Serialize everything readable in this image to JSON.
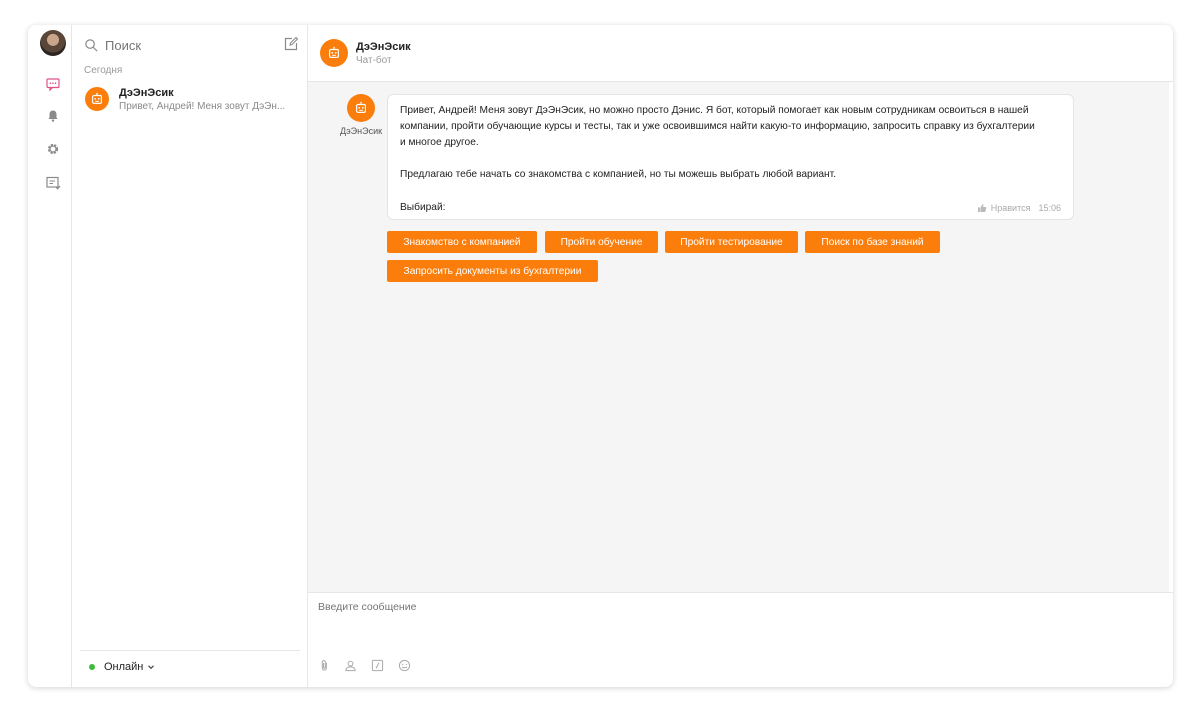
{
  "colors": {
    "accent": "#fb7e0c",
    "online": "#3fba3a",
    "muted": "#9a9a9a"
  },
  "rail": {
    "icons": [
      "chat-icon",
      "bell-icon",
      "gear-icon",
      "tasks-icon"
    ]
  },
  "sidebar": {
    "search_placeholder": "Поиск",
    "group_label": "Сегодня",
    "chats": [
      {
        "name": "ДэЭнЭсик",
        "preview": "Привет, Андрей! Меня зовут ДэЭн..."
      }
    ],
    "status": "Онлайн"
  },
  "header": {
    "name": "ДэЭнЭсик",
    "subtitle": "Чат-бот"
  },
  "message": {
    "author": "ДэЭнЭсик",
    "line1": "Привет, Андрей! Меня зовут ДэЭнЭсик, но можно просто Дэнис. Я бот, который помогает как новым сотрудникам освоиться в нашей",
    "line2": "компании, пройти обучающие курсы и тесты, так и уже освоившимся найти какую-то информацию, запросить справку из бухгалтерии",
    "line3": "и многое другое.",
    "line4": "Предлагаю тебе начать со знакомства с компанией, но ты можешь выбрать любой вариант.",
    "choose": "Выбирай:",
    "like": "Нравится",
    "time": "15:06"
  },
  "actions": {
    "b1": "Знакомство с компанией",
    "b2": "Пройти обучение",
    "b3": "Пройти тестирование",
    "b4": "Поиск по базе знаний",
    "b5": "Запросить документы из бухгалтерии"
  },
  "composer": {
    "placeholder": "Введите сообщение",
    "tools": [
      "paperclip-icon",
      "contact-icon",
      "command-icon",
      "emoji-icon"
    ]
  }
}
